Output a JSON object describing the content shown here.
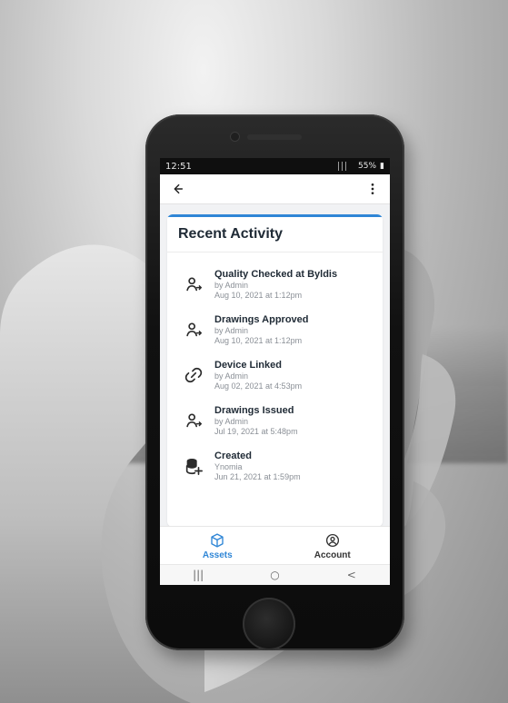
{
  "status_bar": {
    "time": "12:51",
    "battery": "55%"
  },
  "appbar": {
    "back_icon": "arrow-left-icon",
    "more_icon": "more-vert-icon"
  },
  "recent_activity": {
    "title": "Recent Activity",
    "items": [
      {
        "icon": "user-check-icon",
        "title": "Quality Checked at Byldis",
        "by": "by Admin",
        "time": "Aug 10, 2021 at 1:12pm"
      },
      {
        "icon": "user-check-icon",
        "title": "Drawings Approved",
        "by": "by Admin",
        "time": "Aug 10, 2021 at 1:12pm"
      },
      {
        "icon": "link-icon",
        "title": "Device Linked",
        "by": "by Admin",
        "time": "Aug 02, 2021 at 4:53pm"
      },
      {
        "icon": "user-check-icon",
        "title": "Drawings Issued",
        "by": "by Admin",
        "time": "Jul 19, 2021 at 5:48pm"
      },
      {
        "icon": "database-plus-icon",
        "title": "Created",
        "by": "Ynomia",
        "time": "Jun 21, 2021 at 1:59pm"
      }
    ]
  },
  "bottom_nav": {
    "assets_label": "Assets",
    "account_label": "Account",
    "accent": "#2f86d6"
  },
  "android_nav": {
    "recent": "|||",
    "home": "○",
    "back": "<"
  }
}
